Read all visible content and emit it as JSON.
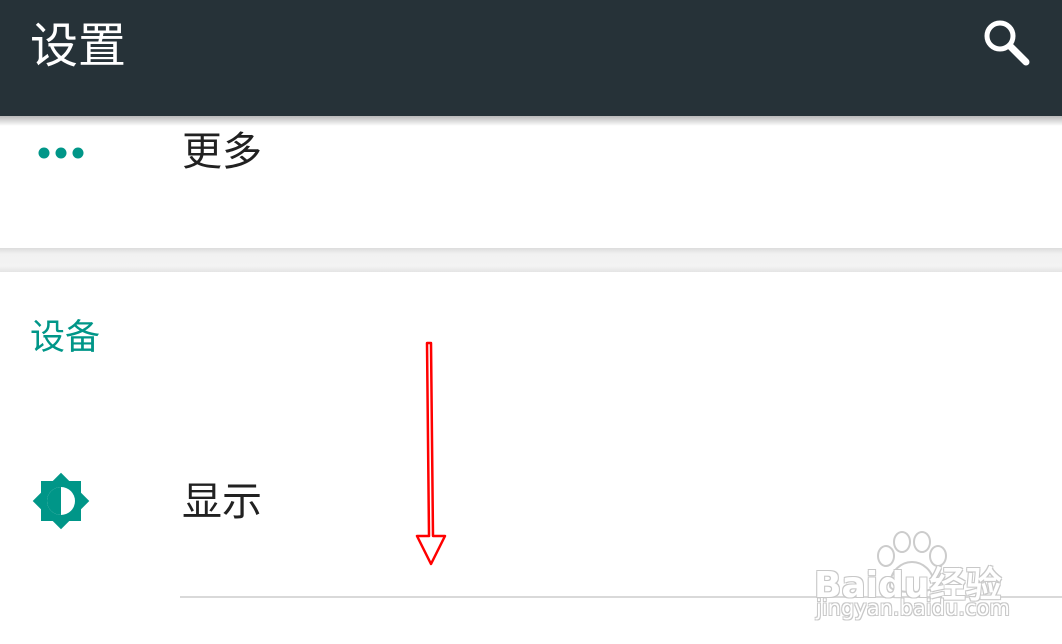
{
  "header": {
    "title": "设置",
    "search_icon": "search-icon",
    "background": "#263238"
  },
  "rows": {
    "more": {
      "label": "更多",
      "icon": "more-horiz-icon"
    },
    "display": {
      "label": "显示",
      "icon": "brightness-icon"
    }
  },
  "sections": {
    "device": {
      "title": "设备"
    }
  },
  "colors": {
    "accent": "#009688",
    "annotation": "#ff0000"
  },
  "watermark": {
    "logo": "Baidu经验",
    "url": "jingyan.baidu.com"
  }
}
